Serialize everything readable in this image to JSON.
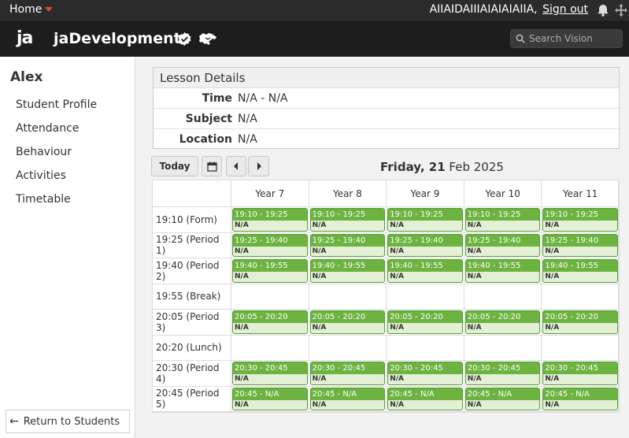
{
  "topbar": {
    "home_label": "Home",
    "user_name": "AIIAIDAIIIAIAIAIAIIA,",
    "signout_label": "Sign out"
  },
  "header": {
    "logo_text": "ja",
    "brand_name": "jaDevelopment",
    "search_placeholder": "Search Vision"
  },
  "sidebar": {
    "student_name": "Alex",
    "items": [
      {
        "label": "Student Profile"
      },
      {
        "label": "Attendance"
      },
      {
        "label": "Behaviour"
      },
      {
        "label": "Activities"
      },
      {
        "label": "Timetable"
      }
    ],
    "return_label": "Return to Students"
  },
  "details": {
    "title": "Lesson Details",
    "rows": [
      {
        "label": "Time",
        "value": "N/A - N/A"
      },
      {
        "label": "Subject",
        "value": "N/A"
      },
      {
        "label": "Location",
        "value": "N/A"
      }
    ]
  },
  "toolbar": {
    "today_label": "Today",
    "date_weekday_bold": "Friday, 21",
    "date_rest": "Feb 2025"
  },
  "timetable": {
    "columns": [
      "Year 7",
      "Year 8",
      "Year 9",
      "Year 10",
      "Year 11"
    ],
    "periods": [
      {
        "label": "19:10 (Form)",
        "lesson_time": "19:10 - 19:25",
        "lesson_subject": "N/A"
      },
      {
        "label": "19:25 (Period 1)",
        "lesson_time": "19:25 - 19:40",
        "lesson_subject": "N/A"
      },
      {
        "label": "19:40 (Period 2)",
        "lesson_time": "19:40 - 19:55",
        "lesson_subject": "N/A"
      },
      {
        "label": "19:55 (Break)",
        "lesson_time": null,
        "lesson_subject": null
      },
      {
        "label": "20:05 (Period 3)",
        "lesson_time": "20:05 - 20:20",
        "lesson_subject": "N/A"
      },
      {
        "label": "20:20 (Lunch)",
        "lesson_time": null,
        "lesson_subject": null
      },
      {
        "label": "20:30 (Period 4)",
        "lesson_time": "20:30 - 20:45",
        "lesson_subject": "N/A"
      },
      {
        "label": "20:45 (Period 5)",
        "lesson_time": "20:45 - N/A",
        "lesson_subject": "N/A"
      }
    ]
  },
  "colors": {
    "accent_green": "#6cb33f",
    "lesson_bg": "#e3f0d6",
    "home_caret": "#e0482f"
  }
}
